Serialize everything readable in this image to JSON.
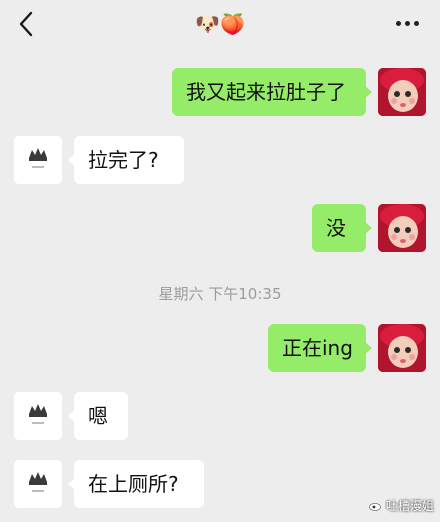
{
  "header": {
    "title": "🐶🍑"
  },
  "timestamp": "星期六 下午10:35",
  "messages": {
    "m1": "我又起来拉肚子了",
    "m2": "拉完了?",
    "m3": "没",
    "m4": "正在ing",
    "m5": "嗯",
    "m6": "在上厕所?"
  },
  "watermark": "吐槽漫姐",
  "colors": {
    "background": "#ededed",
    "bubble_sent": "#95ec69",
    "bubble_received": "#ffffff"
  },
  "icons": {
    "back": "chevron-left-icon",
    "more": "more-dots-icon"
  }
}
